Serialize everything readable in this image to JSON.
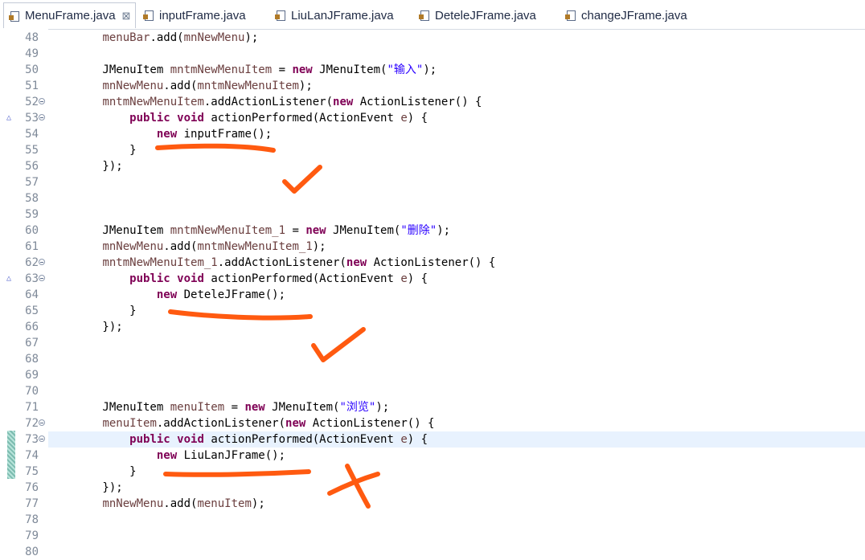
{
  "tabs": [
    {
      "label": "MenuFrame.java",
      "active": true,
      "close": "⊠"
    },
    {
      "label": "inputFrame.java"
    },
    {
      "label": "LiuLanJFrame.java"
    },
    {
      "label": "DeteleJFrame.java"
    },
    {
      "label": "changeJFrame.java"
    }
  ],
  "lines": [
    {
      "num": "48",
      "tokens": [
        {
          "t": "        "
        },
        {
          "t": "menuBar",
          "c": "v"
        },
        {
          "t": ".add("
        },
        {
          "t": "mnNewMenu",
          "c": "v"
        },
        {
          "t": ");"
        }
      ]
    },
    {
      "num": "49",
      "tokens": []
    },
    {
      "num": "50",
      "tokens": [
        {
          "t": "        JMenuItem "
        },
        {
          "t": "mntmNewMenuItem",
          "c": "v"
        },
        {
          "t": " = "
        },
        {
          "t": "new",
          "c": "kw"
        },
        {
          "t": " JMenuItem("
        },
        {
          "t": "\"输入\"",
          "c": "st"
        },
        {
          "t": ");"
        }
      ]
    },
    {
      "num": "51",
      "tokens": [
        {
          "t": "        "
        },
        {
          "t": "mnNewMenu",
          "c": "v"
        },
        {
          "t": ".add("
        },
        {
          "t": "mntmNewMenuItem",
          "c": "v"
        },
        {
          "t": ");"
        }
      ]
    },
    {
      "num": "52",
      "fold": true,
      "tokens": [
        {
          "t": "        "
        },
        {
          "t": "mntmNewMenuItem",
          "c": "v"
        },
        {
          "t": ".addActionListener("
        },
        {
          "t": "new",
          "c": "kw"
        },
        {
          "t": " ActionListener() {"
        }
      ]
    },
    {
      "num": "53",
      "fold": true,
      "override": true,
      "tokens": [
        {
          "t": "            "
        },
        {
          "t": "public",
          "c": "kw"
        },
        {
          "t": " "
        },
        {
          "t": "void",
          "c": "kw"
        },
        {
          "t": " actionPerformed(ActionEvent "
        },
        {
          "t": "e",
          "c": "v"
        },
        {
          "t": ") {"
        }
      ]
    },
    {
      "num": "54",
      "tokens": [
        {
          "t": "                "
        },
        {
          "t": "new",
          "c": "kw"
        },
        {
          "t": " inputFrame();"
        }
      ]
    },
    {
      "num": "55",
      "tokens": [
        {
          "t": "            }"
        }
      ]
    },
    {
      "num": "56",
      "tokens": [
        {
          "t": "        });"
        }
      ]
    },
    {
      "num": "57",
      "tokens": []
    },
    {
      "num": "58",
      "tokens": []
    },
    {
      "num": "59",
      "tokens": []
    },
    {
      "num": "60",
      "tokens": [
        {
          "t": "        JMenuItem "
        },
        {
          "t": "mntmNewMenuItem_1",
          "c": "v"
        },
        {
          "t": " = "
        },
        {
          "t": "new",
          "c": "kw"
        },
        {
          "t": " JMenuItem("
        },
        {
          "t": "\"删除\"",
          "c": "st"
        },
        {
          "t": ");"
        }
      ]
    },
    {
      "num": "61",
      "tokens": [
        {
          "t": "        "
        },
        {
          "t": "mnNewMenu",
          "c": "v"
        },
        {
          "t": ".add("
        },
        {
          "t": "mntmNewMenuItem_1",
          "c": "v"
        },
        {
          "t": ");"
        }
      ]
    },
    {
      "num": "62",
      "fold": true,
      "tokens": [
        {
          "t": "        "
        },
        {
          "t": "mntmNewMenuItem_1",
          "c": "v"
        },
        {
          "t": ".addActionListener("
        },
        {
          "t": "new",
          "c": "kw"
        },
        {
          "t": " ActionListener() {"
        }
      ]
    },
    {
      "num": "63",
      "fold": true,
      "override": true,
      "tokens": [
        {
          "t": "            "
        },
        {
          "t": "public",
          "c": "kw"
        },
        {
          "t": " "
        },
        {
          "t": "void",
          "c": "kw"
        },
        {
          "t": " actionPerformed(ActionEvent "
        },
        {
          "t": "e",
          "c": "v"
        },
        {
          "t": ") {"
        }
      ]
    },
    {
      "num": "64",
      "tokens": [
        {
          "t": "                "
        },
        {
          "t": "new",
          "c": "kw"
        },
        {
          "t": " DeteleJFrame();"
        }
      ]
    },
    {
      "num": "65",
      "tokens": [
        {
          "t": "            }"
        }
      ]
    },
    {
      "num": "66",
      "tokens": [
        {
          "t": "        });"
        }
      ]
    },
    {
      "num": "67",
      "tokens": []
    },
    {
      "num": "68",
      "tokens": []
    },
    {
      "num": "69",
      "tokens": []
    },
    {
      "num": "70",
      "tokens": []
    },
    {
      "num": "71",
      "tokens": [
        {
          "t": "        JMenuItem "
        },
        {
          "t": "menuItem",
          "c": "v"
        },
        {
          "t": " = "
        },
        {
          "t": "new",
          "c": "kw"
        },
        {
          "t": " JMenuItem("
        },
        {
          "t": "\"浏览\"",
          "c": "st"
        },
        {
          "t": ");"
        }
      ]
    },
    {
      "num": "72",
      "fold": true,
      "tokens": [
        {
          "t": "        "
        },
        {
          "t": "menuItem",
          "c": "v"
        },
        {
          "t": ".addActionListener("
        },
        {
          "t": "new",
          "c": "kw"
        },
        {
          "t": " ActionListener() {"
        }
      ]
    },
    {
      "num": "73",
      "fold": true,
      "highlight": true,
      "tokens": [
        {
          "t": "            "
        },
        {
          "t": "public",
          "c": "kw"
        },
        {
          "t": " "
        },
        {
          "t": "void",
          "c": "kw"
        },
        {
          "t": " actionPerformed(ActionEvent "
        },
        {
          "t": "e",
          "c": "v"
        },
        {
          "t": ") {"
        }
      ]
    },
    {
      "num": "74",
      "tokens": [
        {
          "t": "                "
        },
        {
          "t": "new",
          "c": "kw"
        },
        {
          "t": " LiuLanJFrame();"
        }
      ]
    },
    {
      "num": "75",
      "tokens": [
        {
          "t": "            }"
        }
      ]
    },
    {
      "num": "76",
      "tokens": [
        {
          "t": "        });"
        }
      ]
    },
    {
      "num": "77",
      "tokens": [
        {
          "t": "        "
        },
        {
          "t": "mnNewMenu",
          "c": "v"
        },
        {
          "t": ".add("
        },
        {
          "t": "menuItem",
          "c": "v"
        },
        {
          "t": ");"
        }
      ]
    },
    {
      "num": "78",
      "tokens": []
    },
    {
      "num": "79",
      "tokens": []
    },
    {
      "num": "80",
      "tokens": []
    }
  ],
  "annotation_color": "#ff5a10"
}
